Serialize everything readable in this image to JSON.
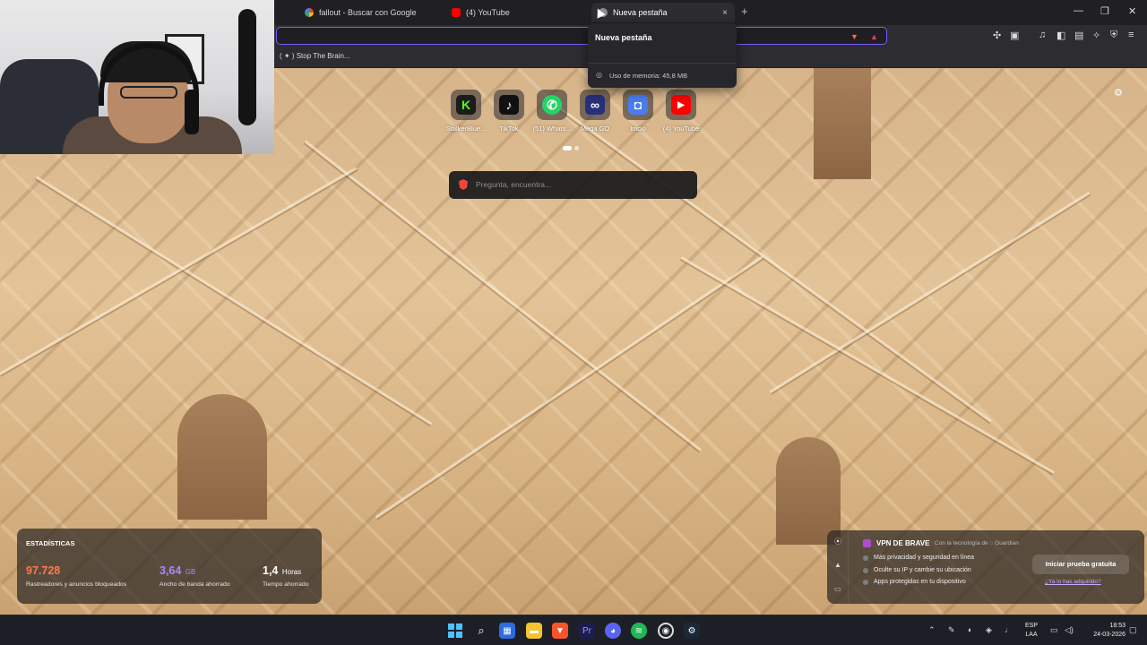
{
  "tabs": [
    {
      "label": "fallout - Buscar con Google",
      "icon": "google-icon"
    },
    {
      "label": "(4) YouTube",
      "icon": "youtube-icon"
    },
    {
      "label": "Nueva pestaña",
      "icon": "brave-icon",
      "active": true
    }
  ],
  "tab_close": "×",
  "new_tab": "+",
  "window_controls": {
    "minimize": "—",
    "maximize": "❐",
    "close": "✕"
  },
  "bookmark": {
    "label": "( ✦ ) Stop The Brain..."
  },
  "hover_card": {
    "title": "Nueva pestaña",
    "memory": "Uso de memoria: 45,8 MB"
  },
  "shortcuts": [
    {
      "label": "StalkerBlue...",
      "letter": "K",
      "color": "#1b1b1b",
      "fg": "#53fc18"
    },
    {
      "label": "TikTok",
      "letter": "♪",
      "color": "#111111",
      "fg": "#ffffff"
    },
    {
      "label": "(51) Whats...",
      "letter": "✆",
      "color": "#25d366",
      "fg": "#ffffff"
    },
    {
      "label": "Mega GO",
      "letter": "∞",
      "color": "#27307a",
      "fg": "#ffffff"
    },
    {
      "label": "Inicio",
      "letter": "◘",
      "color": "#4a7cf0",
      "fg": "#ffffff"
    },
    {
      "label": "(4) YouTube",
      "letter": "▶",
      "color": "#ff0000",
      "fg": "#ffffff"
    }
  ],
  "search": {
    "placeholder": "Pregunta, encuentra..."
  },
  "stats": {
    "title": "ESTADÍSTICAS",
    "trackers": {
      "value": "97.728",
      "desc": "Rastreadores y anuncios bloqueados"
    },
    "bandwidth": {
      "value": "3,64",
      "unit": "GB",
      "desc": "Ancho de banda ahorrado"
    },
    "time": {
      "value": "1,4",
      "unit": "Horas",
      "desc": "Tiempo ahorrado"
    }
  },
  "vpn": {
    "title": "VPN DE BRAVE",
    "subtitle": "Con la tecnología de ◌ Guardian",
    "features": [
      "Más privacidad y seguridad en línea",
      "Oculte su IP y cambie su ubicación",
      "Apps protegidas en tu dispositivo"
    ],
    "cta": "Iniciar prueba gratuita",
    "link": "¿Ya lo has adquirido?"
  },
  "taskbar": {
    "lang": [
      "ESP",
      "LAA"
    ],
    "time": "18:53",
    "date": "24-03-2026"
  }
}
